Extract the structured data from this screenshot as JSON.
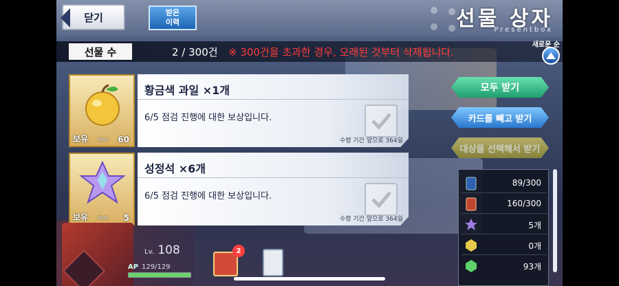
{
  "header": {
    "close_label": "닫기",
    "history_label_line1": "받은",
    "history_label_line2": "이력",
    "title": "선물 상자",
    "subtitle": "Presentbox"
  },
  "count_bar": {
    "label": "선물 수",
    "value": "2 / 300건",
    "notice": "※ 300건을 초과한 경우, 오래된 것부터 삭제됩니다."
  },
  "sort": {
    "label": "새로운 순"
  },
  "gifts": [
    {
      "name": "황금색 과일 ×1개",
      "description": "6/5 점검 진행에 대한 보상입니다.",
      "owned_label": "보유",
      "item_label": "Item",
      "owned_count": "60",
      "expire": "수령 기간 앞으로 364일",
      "icon": "golden-apple-icon"
    },
    {
      "name": "성정석 ×6개",
      "description": "6/5 점검 진행에 대한 보상입니다.",
      "owned_label": "보유",
      "item_label": "Item",
      "owned_count": "5",
      "expire": "수령 기간 앞으로 364일",
      "icon": "saint-quartz-icon"
    }
  ],
  "actions": {
    "receive_all": "모두 받기",
    "receive_except_cards": "카드를 빼고 받기",
    "select_and_receive": "대상을 선택해서 받기"
  },
  "inventory": [
    {
      "icon": "servant-card-icon",
      "value": "89/300",
      "color": "#2f5fb0"
    },
    {
      "icon": "craft-essence-icon",
      "value": "160/300",
      "color": "#c0452e"
    },
    {
      "icon": "saint-quartz-icon",
      "value": "5개",
      "color": "#9f7de0"
    },
    {
      "icon": "golden-gem-icon",
      "value": "0개",
      "color": "#e8c84a"
    },
    {
      "icon": "green-gem-icon",
      "value": "93개",
      "color": "#5fd06a"
    }
  ],
  "player": {
    "level_prefix": "Lv.",
    "level": "108",
    "ap_label": "AP",
    "ap_value": "129/129",
    "ap_fill": 1.0,
    "gift_badge": "2"
  }
}
